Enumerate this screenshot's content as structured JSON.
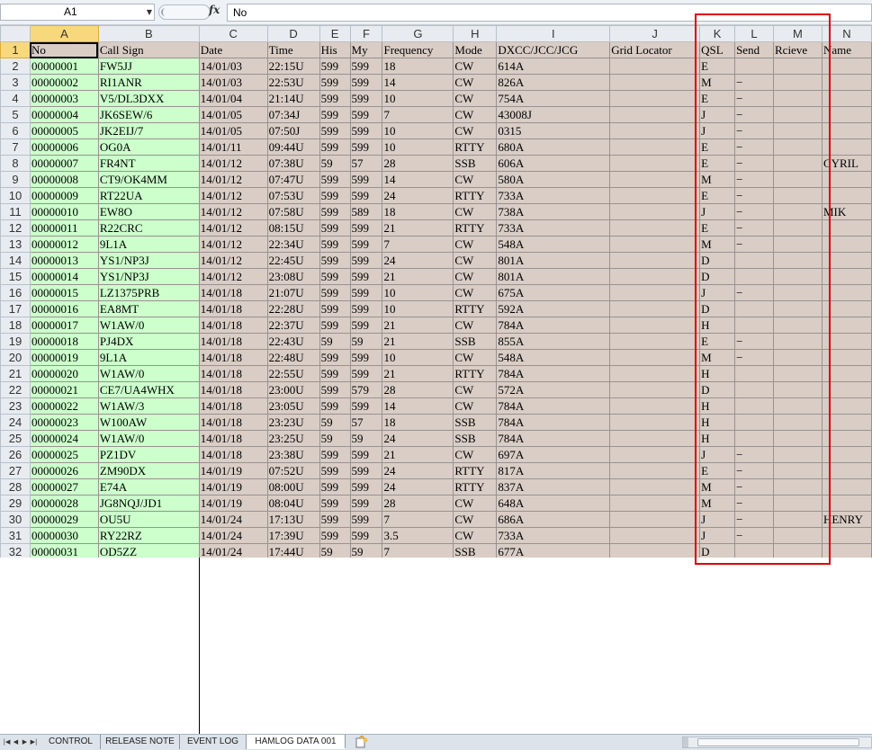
{
  "formula_bar": {
    "name_box": "A1",
    "fx_label": "fx",
    "formula": "No"
  },
  "columns": [
    "A",
    "B",
    "C",
    "D",
    "E",
    "F",
    "G",
    "H",
    "I",
    "J",
    "K",
    "L",
    "M",
    "N"
  ],
  "selected_column": "A",
  "header_row": {
    "number": "1",
    "cells": [
      "No",
      "Call Sign",
      "Date",
      "Time",
      "His",
      "My",
      "Frequency",
      "Mode",
      "DXCC/JCC/JCG",
      "Grid Locator",
      "QSL",
      "Send",
      "Rcieve",
      "Name"
    ]
  },
  "rows": [
    {
      "n": "2",
      "cells": [
        "00000001",
        "FW5JJ",
        "14/01/03",
        "22:15U",
        "599",
        "599",
        "18",
        "CW",
        "614A",
        "",
        "E",
        "",
        ""
      ]
    },
    {
      "n": "3",
      "cells": [
        "00000002",
        "RI1ANR",
        "14/01/03",
        "22:53U",
        "599",
        "599",
        "14",
        "CW",
        "826A",
        "",
        "M",
        "−",
        ""
      ]
    },
    {
      "n": "4",
      "cells": [
        "00000003",
        "V5/DL3DXX",
        "14/01/04",
        "21:14U",
        "599",
        "599",
        "10",
        "CW",
        "754A",
        "",
        "E",
        "−",
        ""
      ]
    },
    {
      "n": "5",
      "cells": [
        "00000004",
        "JK6SEW/6",
        "14/01/05",
        "07:34J",
        "599",
        "599",
        "7",
        "CW",
        "43008J",
        "",
        "J",
        "−",
        ""
      ]
    },
    {
      "n": "6",
      "cells": [
        "00000005",
        "JK2EIJ/7",
        "14/01/05",
        "07:50J",
        "599",
        "599",
        "10",
        "CW",
        "0315",
        "",
        "J",
        "−",
        ""
      ]
    },
    {
      "n": "7",
      "cells": [
        "00000006",
        "OG0A",
        "14/01/11",
        "09:44U",
        "599",
        "599",
        "10",
        "RTTY",
        "680A",
        "",
        "E",
        "−",
        ""
      ]
    },
    {
      "n": "8",
      "cells": [
        "00000007",
        "FR4NT",
        "14/01/12",
        "07:38U",
        "59",
        "57",
        "28",
        "SSB",
        "606A",
        "",
        "E",
        "−",
        "",
        "CYRIL"
      ]
    },
    {
      "n": "9",
      "cells": [
        "00000008",
        "CT9/OK4MM",
        "14/01/12",
        "07:47U",
        "599",
        "599",
        "14",
        "CW",
        "580A",
        "",
        "M",
        "−",
        ""
      ]
    },
    {
      "n": "10",
      "cells": [
        "00000009",
        "RT22UA",
        "14/01/12",
        "07:53U",
        "599",
        "599",
        "24",
        "RTTY",
        "733A",
        "",
        "E",
        "−",
        ""
      ]
    },
    {
      "n": "11",
      "cells": [
        "00000010",
        "EW8O",
        "14/01/12",
        "07:58U",
        "599",
        "589",
        "18",
        "CW",
        "738A",
        "",
        "J",
        "−",
        "",
        "MIK"
      ]
    },
    {
      "n": "12",
      "cells": [
        "00000011",
        "R22CRC",
        "14/01/12",
        "08:15U",
        "599",
        "599",
        "21",
        "RTTY",
        "733A",
        "",
        "E",
        "−",
        ""
      ]
    },
    {
      "n": "13",
      "cells": [
        "00000012",
        "9L1A",
        "14/01/12",
        "22:34U",
        "599",
        "599",
        "7",
        "CW",
        "548A",
        "",
        "M",
        "−",
        ""
      ]
    },
    {
      "n": "14",
      "cells": [
        "00000013",
        "YS1/NP3J",
        "14/01/12",
        "22:45U",
        "599",
        "599",
        "24",
        "CW",
        "801A",
        "",
        "D",
        "",
        ""
      ]
    },
    {
      "n": "15",
      "cells": [
        "00000014",
        "YS1/NP3J",
        "14/01/12",
        "23:08U",
        "599",
        "599",
        "21",
        "CW",
        "801A",
        "",
        "D",
        "",
        ""
      ]
    },
    {
      "n": "16",
      "cells": [
        "00000015",
        "LZ1375PRB",
        "14/01/18",
        "21:07U",
        "599",
        "599",
        "10",
        "CW",
        "675A",
        "",
        "J",
        "−",
        ""
      ]
    },
    {
      "n": "17",
      "cells": [
        "00000016",
        "EA8MT",
        "14/01/18",
        "22:28U",
        "599",
        "599",
        "10",
        "RTTY",
        "592A",
        "",
        "D",
        "",
        ""
      ]
    },
    {
      "n": "18",
      "cells": [
        "00000017",
        "W1AW/0",
        "14/01/18",
        "22:37U",
        "599",
        "599",
        "21",
        "CW",
        "784A",
        "",
        "H",
        "",
        ""
      ]
    },
    {
      "n": "19",
      "cells": [
        "00000018",
        "PJ4DX",
        "14/01/18",
        "22:43U",
        "59",
        "59",
        "21",
        "SSB",
        "855A",
        "",
        "E",
        "−",
        ""
      ]
    },
    {
      "n": "20",
      "cells": [
        "00000019",
        "9L1A",
        "14/01/18",
        "22:48U",
        "599",
        "599",
        "10",
        "CW",
        "548A",
        "",
        "M",
        "−",
        ""
      ]
    },
    {
      "n": "21",
      "cells": [
        "00000020",
        "W1AW/0",
        "14/01/18",
        "22:55U",
        "599",
        "599",
        "21",
        "RTTY",
        "784A",
        "",
        "H",
        "",
        ""
      ]
    },
    {
      "n": "22",
      "cells": [
        "00000021",
        "CE7/UA4WHX",
        "14/01/18",
        "23:00U",
        "599",
        "579",
        "28",
        "CW",
        "572A",
        "",
        "D",
        "",
        ""
      ]
    },
    {
      "n": "23",
      "cells": [
        "00000022",
        "W1AW/3",
        "14/01/18",
        "23:05U",
        "599",
        "599",
        "14",
        "CW",
        "784A",
        "",
        "H",
        "",
        ""
      ]
    },
    {
      "n": "24",
      "cells": [
        "00000023",
        "W100AW",
        "14/01/18",
        "23:23U",
        "59",
        "57",
        "18",
        "SSB",
        "784A",
        "",
        "H",
        "",
        ""
      ]
    },
    {
      "n": "25",
      "cells": [
        "00000024",
        "W1AW/0",
        "14/01/18",
        "23:25U",
        "59",
        "59",
        "24",
        "SSB",
        "784A",
        "",
        "H",
        "",
        ""
      ]
    },
    {
      "n": "26",
      "cells": [
        "00000025",
        "PZ1DV",
        "14/01/18",
        "23:38U",
        "599",
        "599",
        "21",
        "CW",
        "697A",
        "",
        "J",
        "−",
        ""
      ]
    },
    {
      "n": "27",
      "cells": [
        "00000026",
        "ZM90DX",
        "14/01/19",
        "07:52U",
        "599",
        "599",
        "24",
        "RTTY",
        "817A",
        "",
        "E",
        "−",
        ""
      ]
    },
    {
      "n": "28",
      "cells": [
        "00000027",
        "E74A",
        "14/01/19",
        "08:00U",
        "599",
        "599",
        "24",
        "RTTY",
        "837A",
        "",
        "M",
        "−",
        ""
      ]
    },
    {
      "n": "29",
      "cells": [
        "00000028",
        "JG8NQJ/JD1",
        "14/01/19",
        "08:04U",
        "599",
        "599",
        "28",
        "CW",
        "648A",
        "",
        "M",
        "−",
        ""
      ]
    },
    {
      "n": "30",
      "cells": [
        "00000029",
        "OU5U",
        "14/01/24",
        "17:13U",
        "599",
        "599",
        "7",
        "CW",
        "686A",
        "",
        "J",
        "−",
        "",
        "HENRY"
      ]
    },
    {
      "n": "31",
      "cells": [
        "00000030",
        "RY22RZ",
        "14/01/24",
        "17:39U",
        "599",
        "599",
        "3.5",
        "CW",
        "733A",
        "",
        "J",
        "−",
        ""
      ]
    },
    {
      "n": "32",
      "cells": [
        "00000031",
        "OD5ZZ",
        "14/01/24",
        "17:44U",
        "59",
        "59",
        "7",
        "SSB",
        "677A",
        "",
        "D",
        "",
        ""
      ]
    }
  ],
  "sheet_tabs": {
    "nav_first": "◀◀",
    "nav_prev": "◀",
    "nav_next": "▶",
    "nav_last": "▶▶",
    "tabs": [
      "CONTROL",
      "RELEASE NOTE",
      "EVENT LOG",
      "HAMLOG DATA 001"
    ],
    "active_tab": "HAMLOG DATA 001"
  },
  "colors": {
    "green_cells": "#ccffcc",
    "data_cells": "#d9cdc5",
    "selected_header": "#f8d87c",
    "annotation_red": "#e00000"
  },
  "icons": {
    "name_dropdown": "chevron-down-icon",
    "new_sheet": "insert-worksheet-icon"
  }
}
